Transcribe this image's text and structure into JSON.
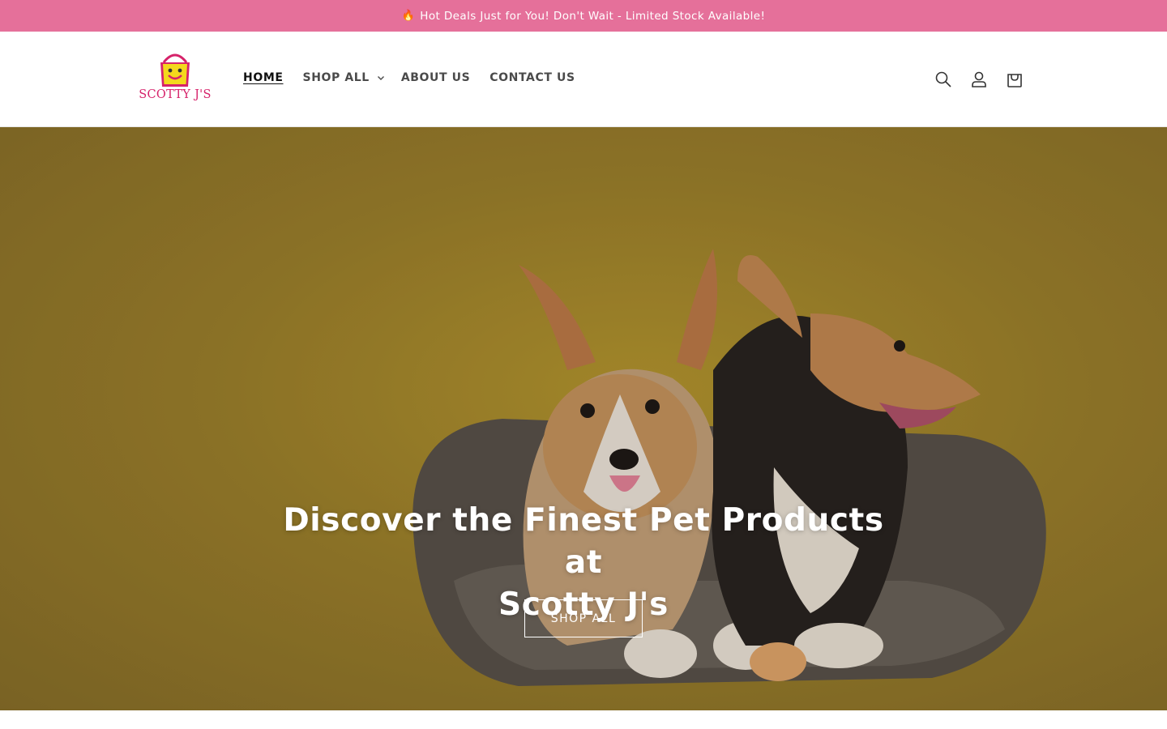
{
  "announcement": {
    "text": "Hot Deals Just for You! Don't Wait - Limited Stock Available!",
    "icon": "flame-icon",
    "background": "#e5709a"
  },
  "header": {
    "logo_text": "SCOTTY J'S",
    "nav": [
      {
        "label": "HOME",
        "active": true
      },
      {
        "label": "SHOP ALL",
        "has_dropdown": true
      },
      {
        "label": "ABOUT US"
      },
      {
        "label": "CONTACT US"
      }
    ],
    "icons": [
      "search-icon",
      "account-icon",
      "cart-icon"
    ]
  },
  "hero": {
    "title_line1": "Discover the Finest Pet Products at",
    "title_line2": "Scotty J's",
    "button_label": "SHOP ALL",
    "background": "#a38630"
  },
  "colors": {
    "brand_pink": "#d6226a",
    "logo_yellow": "#f4d81c"
  }
}
